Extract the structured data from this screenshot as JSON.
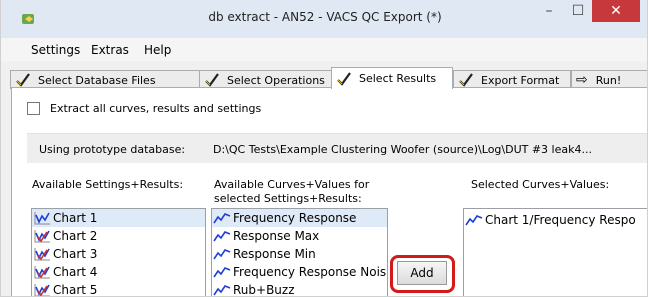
{
  "window": {
    "title": "db extract - AN52 - VACS QC Export (*)",
    "minimize": "–",
    "maximize": "☐",
    "close": "✕"
  },
  "menu": [
    "Settings",
    "Extras",
    "Help"
  ],
  "tabs": [
    {
      "label": "Select Database Files",
      "icon": "check-mark-icon"
    },
    {
      "label": "Select Operations",
      "icon": "check-mark-icon"
    },
    {
      "label": "Select Results",
      "icon": "check-mark-icon",
      "active": true
    },
    {
      "label": "Export Format",
      "icon": "check-mark-icon"
    },
    {
      "label": "Run!",
      "icon": "arrow-right-icon"
    }
  ],
  "extract_all": {
    "label": "Extract all curves, results and settings",
    "checked": false
  },
  "prototype": {
    "label": "Using prototype database:",
    "path": "D:\\QC Tests\\Example Clustering Woofer (source)\\Log\\DUT #3 leak4..."
  },
  "columns": {
    "available_settings": "Available Settings+Results:",
    "available_curves_line1": "Available Curves+Values for",
    "available_curves_line2": "selected Settings+Results:",
    "selected_curves": "Selected Curves+Values:"
  },
  "settings_list": [
    "Chart 1",
    "Chart 2",
    "Chart 3",
    "Chart 4",
    "Chart 5"
  ],
  "curves_list": [
    "Frequency Response",
    "Response Max",
    "Response Min",
    "Frequency Response Nois",
    "Rub+Buzz"
  ],
  "selected_list": [
    "Chart 1/Frequency Respo"
  ],
  "add_button": "Add",
  "colors": {
    "accent_blue": "#1e3fd8",
    "highlight_red": "#d11a1a",
    "selection": "#dfeaf8",
    "close": "#c7383c"
  }
}
